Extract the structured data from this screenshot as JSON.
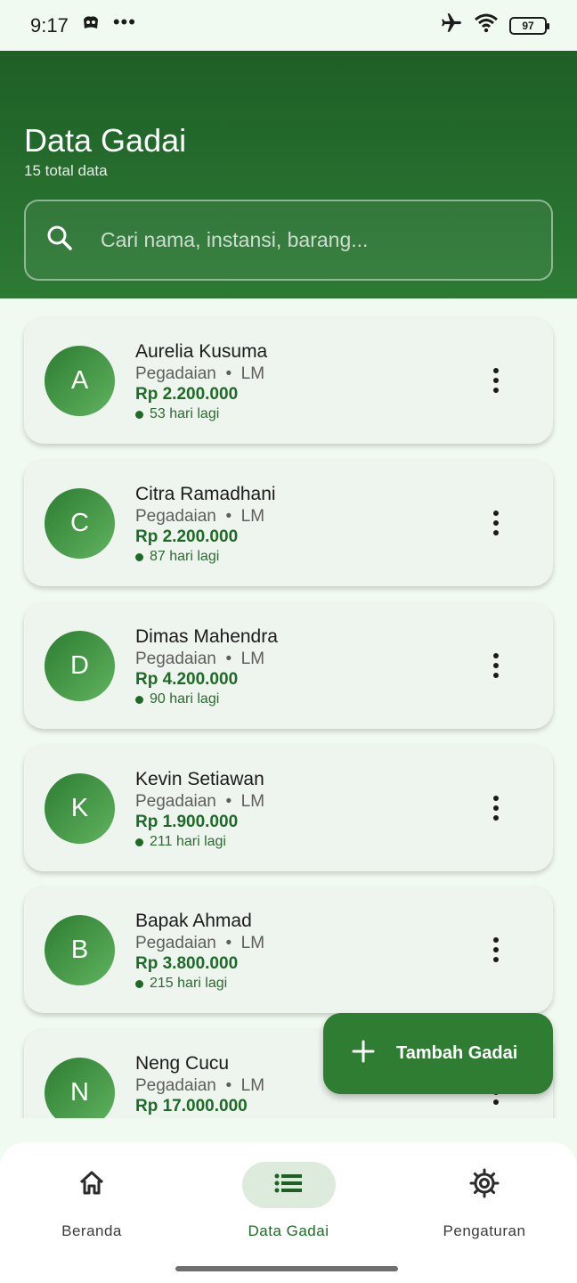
{
  "status_bar": {
    "time": "9:17",
    "dots": "•••",
    "battery": "97"
  },
  "header": {
    "title": "Data Gadai",
    "subtitle": "15 total data",
    "search_placeholder": "Cari nama, instansi, barang..."
  },
  "records": [
    {
      "initial": "A",
      "name": "Aurelia Kusuma",
      "institution": "Pegadaian",
      "item": "LM",
      "amount": "Rp 2.200.000",
      "due": "53 hari lagi"
    },
    {
      "initial": "C",
      "name": "Citra Ramadhani",
      "institution": "Pegadaian",
      "item": "LM",
      "amount": "Rp 2.200.000",
      "due": "87 hari lagi"
    },
    {
      "initial": "D",
      "name": "Dimas Mahendra",
      "institution": "Pegadaian",
      "item": "LM",
      "amount": "Rp 4.200.000",
      "due": "90 hari lagi"
    },
    {
      "initial": "K",
      "name": "Kevin Setiawan",
      "institution": "Pegadaian",
      "item": "LM",
      "amount": "Rp 1.900.000",
      "due": "211 hari lagi"
    },
    {
      "initial": "B",
      "name": "Bapak Ahmad",
      "institution": "Pegadaian",
      "item": "LM",
      "amount": "Rp 3.800.000",
      "due": "215 hari lagi"
    },
    {
      "initial": "N",
      "name": "Neng Cucu",
      "institution": "Pegadaian",
      "item": "LM",
      "amount": "Rp 17.000.000",
      "due": ""
    }
  ],
  "meta_separator": "•",
  "fab": {
    "label": "Tambah Gadai",
    "icon": "plus-icon"
  },
  "bottom_nav": [
    {
      "label": "Beranda",
      "icon": "home-icon",
      "active": false
    },
    {
      "label": "Data Gadai",
      "icon": "list-icon",
      "active": true
    },
    {
      "label": "Pengaturan",
      "icon": "gear-icon",
      "active": false
    }
  ],
  "colors": {
    "primary": "#2e7d32",
    "header_dark": "#1e5f26",
    "amount": "#1e6b27",
    "background": "#f1faf0"
  }
}
